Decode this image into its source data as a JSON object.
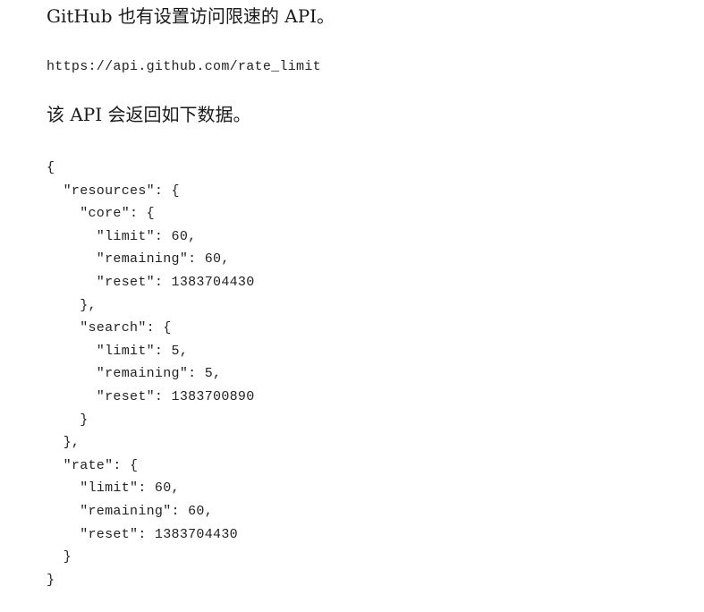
{
  "intro_text": "GitHub 也有设置访问限速的 API。",
  "api_url": "https://api.github.com/rate_limit",
  "return_text": "该 API 会返回如下数据。",
  "code_lines": [
    "{",
    "  \"resources\": {",
    "    \"core\": {",
    "      \"limit\": 60,",
    "      \"remaining\": 60,",
    "      \"reset\": 1383704430",
    "    },",
    "    \"search\": {",
    "      \"limit\": 5,",
    "      \"remaining\": 5,",
    "      \"reset\": 1383700890",
    "    }",
    "  },",
    "  \"rate\": {",
    "    \"limit\": 60,",
    "    \"remaining\": 60,",
    "    \"reset\": 1383704430",
    "  }",
    "}"
  ]
}
